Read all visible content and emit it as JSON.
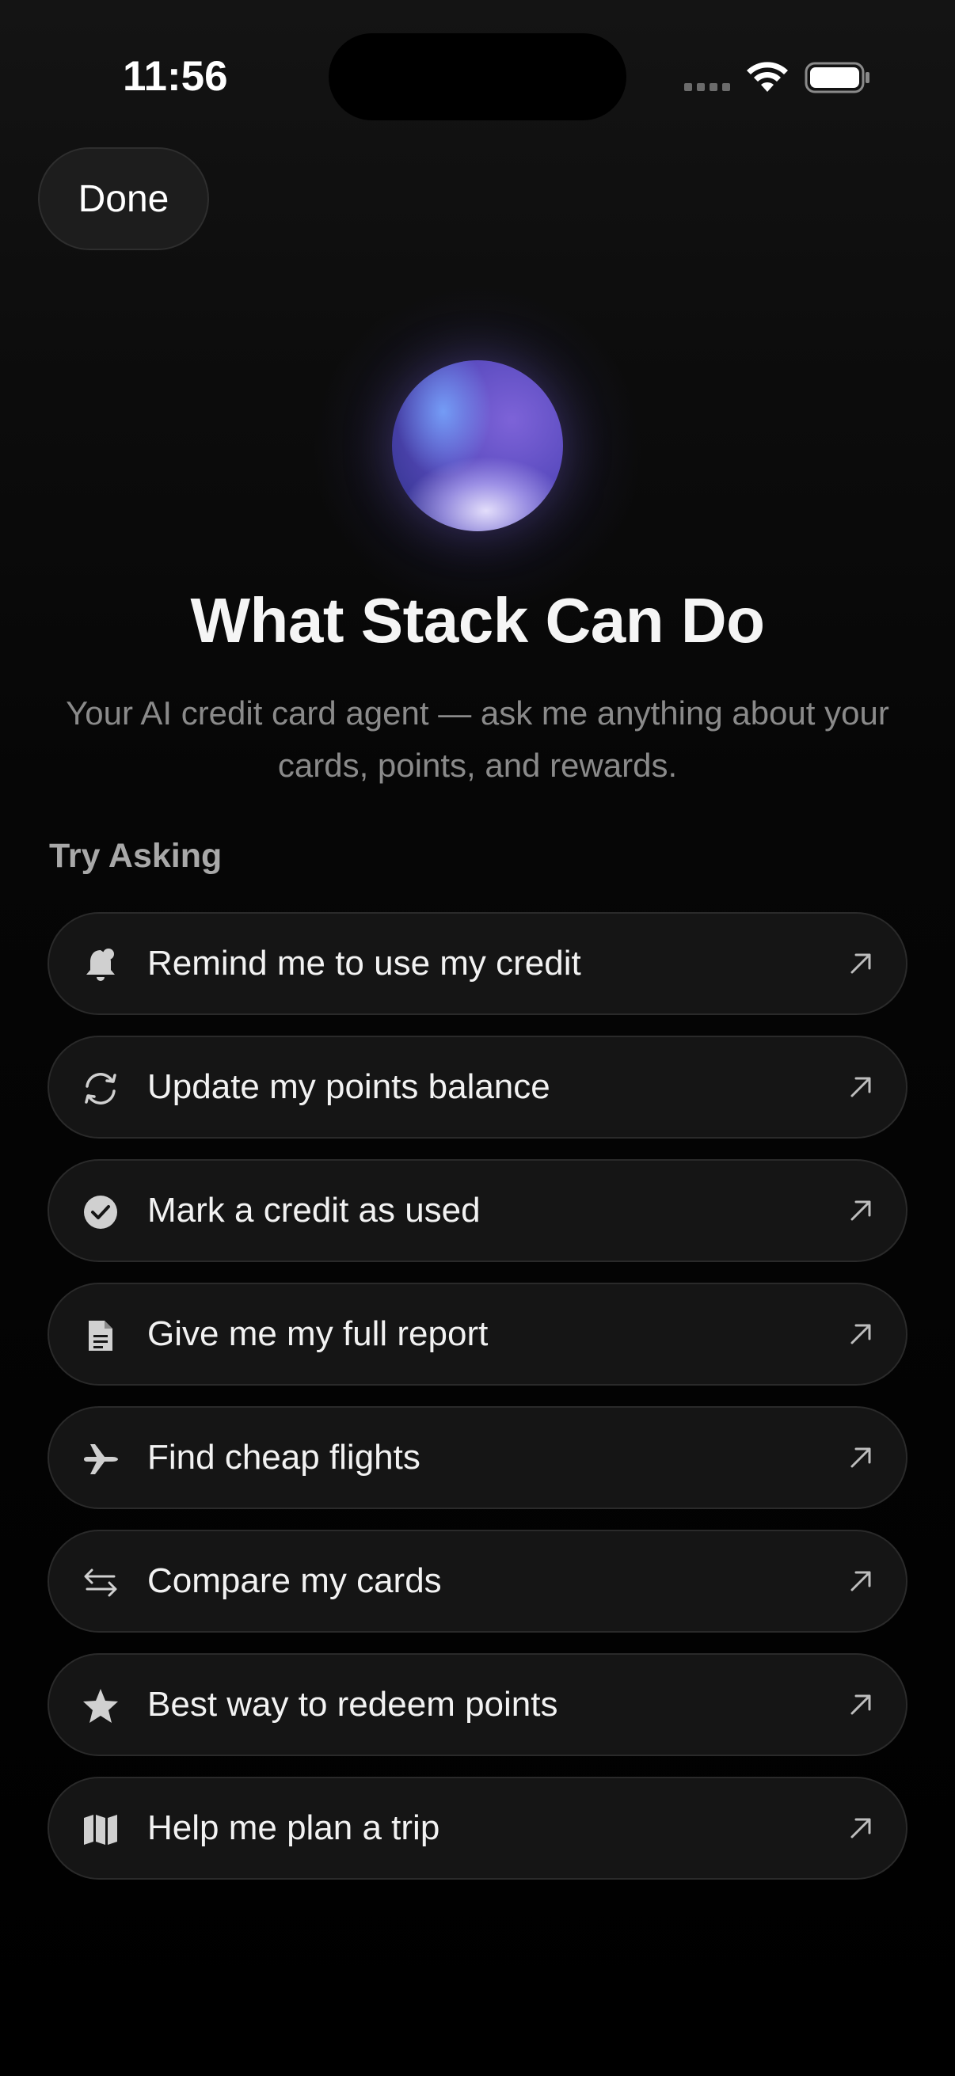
{
  "status_bar": {
    "time": "11:56"
  },
  "header": {
    "done_label": "Done"
  },
  "intro": {
    "title": "What Stack Can Do",
    "subtitle": "Your AI credit card agent — ask me anything about your cards, points, and rewards."
  },
  "suggestions_section": {
    "label": "Try Asking",
    "items": [
      {
        "label": "Remind me to use my credit",
        "icon": "bell-badge-icon"
      },
      {
        "label": "Update my points balance",
        "icon": "refresh-icon"
      },
      {
        "label": "Mark a credit as used",
        "icon": "checkmark-circle-icon"
      },
      {
        "label": "Give me my full report",
        "icon": "document-icon"
      },
      {
        "label": "Find cheap flights",
        "icon": "airplane-icon"
      },
      {
        "label": "Compare my cards",
        "icon": "swap-arrows-icon"
      },
      {
        "label": "Best way to redeem points",
        "icon": "star-icon"
      },
      {
        "label": "Help me plan a trip",
        "icon": "map-icon"
      }
    ]
  },
  "colors": {
    "background": "#000000",
    "pill_background": "#151515",
    "pill_border": "#2a2a2a",
    "icon_color": "#d0d0d0",
    "subtitle_text": "#8a8a8a",
    "orb_accent": "#6a5ad0"
  }
}
